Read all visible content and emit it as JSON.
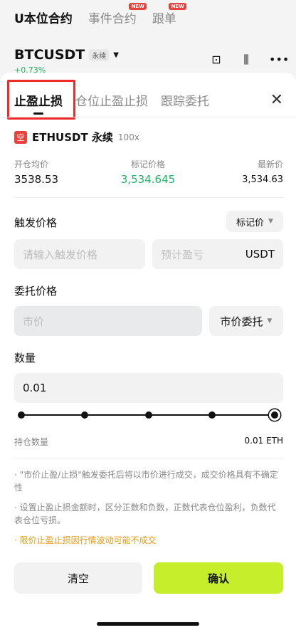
{
  "top_tabs": [
    {
      "label": "U本位合约",
      "badge": ""
    },
    {
      "label": "事件合约",
      "badge": "NEW"
    },
    {
      "label": "跟单",
      "badge": "NEW"
    }
  ],
  "pair": {
    "name": "BTCUSDT",
    "tag": "永续",
    "change": "+0.73%"
  },
  "sheet": {
    "tabs": [
      "止盈止损",
      "仓位止盈止损",
      "跟踪委托"
    ],
    "close": "✕",
    "symbol": {
      "badge": "空",
      "name": "ETHUSDT 永续",
      "leverage": "100x"
    },
    "prices": {
      "entry_label": "开仓均价",
      "entry_value": "3538.53",
      "mark_label": "标记价格",
      "mark_value": "3,534.645",
      "last_label": "最新价",
      "last_value": "3,534.63"
    },
    "trigger": {
      "label": "触发价格",
      "type": "标记价",
      "placeholder": "请输入触发价格",
      "pnl_placeholder": "预计盈亏",
      "unit": "USDT"
    },
    "order": {
      "label": "委托价格",
      "placeholder": "市价",
      "type": "市价委托"
    },
    "qty": {
      "label": "数量",
      "value": "0.01",
      "slider_fraction": 1.0
    },
    "hold": {
      "label": "持仓数量",
      "value": "0.01 ETH"
    },
    "notes": [
      "· \"市价止盈/止损\"触发委托后将以市价进行成交，成交价格具有不确定性",
      "· 设置止盈止损金额时，区分正数和负数，正数代表仓位盈利，负数代表仓位亏损。",
      "· 限价止盈止损因行情波动可能不成交"
    ],
    "clear_label": "清空",
    "confirm_label": "确认"
  },
  "colors": {
    "accent": "#c6ee2a",
    "green": "#1eb464",
    "red": "#e8423c",
    "warn": "#e89a12"
  }
}
